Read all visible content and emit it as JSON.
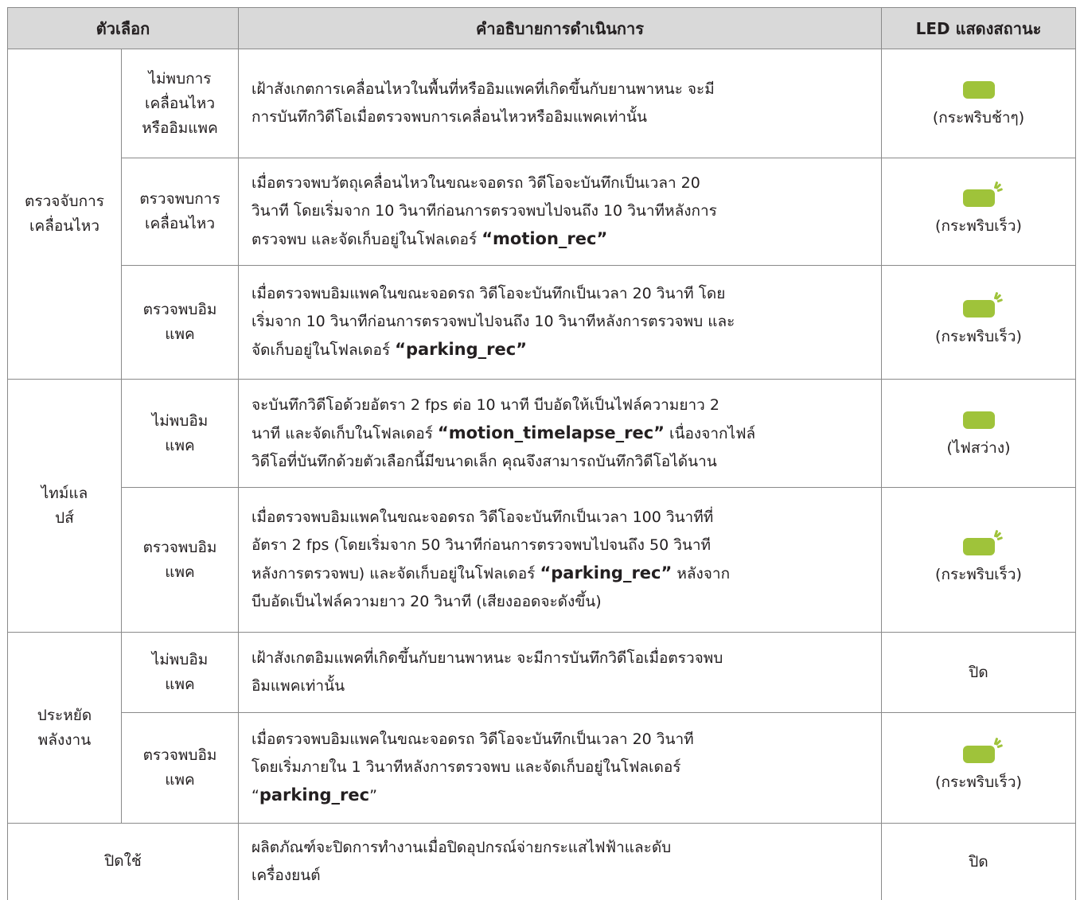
{
  "header": {
    "option": "ตัวเลือก",
    "description": "คำอธิบายการดำเนินการ",
    "led": "LED แสดงสถานะ"
  },
  "colors": {
    "led_green": "#9fc33a",
    "header_bg": "#d9d9d9",
    "grid": "#8a8a8a"
  },
  "groups": [
    {
      "name": [
        "ตรวจจับการ",
        "เคลื่อนไหว"
      ]
    },
    {
      "name": [
        "ไทม์แล",
        "ปส์"
      ]
    },
    {
      "name": [
        "ประหยัด",
        "พลังงาน"
      ]
    }
  ],
  "rows": [
    {
      "sub": [
        "ไม่พบการ",
        "เคลื่อนไหว",
        "หรืออิมแพค"
      ],
      "desc": [
        [
          {
            "t": "เฝ้าสังเกตการเคลื่อนไหวในพื้นที่หรืออิมแพคที่เกิดขึ้นกับยานพาหนะ จะมี"
          }
        ],
        [
          {
            "t": "การบันทึกวิดีโอเมื่อตรวจพบการเคลื่อนไหวหรืออิมแพคเท่านั้น"
          }
        ]
      ],
      "led": {
        "icon": "led-steady-icon",
        "label": "(กระพริบช้าๆ)"
      }
    },
    {
      "sub": [
        "ตรวจพบการ",
        "เคลื่อนไหว"
      ],
      "desc": [
        [
          {
            "t": "เมื่อตรวจพบวัตถุเคลื่อนไหวในขณะจอดรถ วิดีโอจะบันทึกเป็นเวลา 20"
          }
        ],
        [
          {
            "t": "วินาที โดยเริ่มจาก 10 วินาทีก่อนการตรวจพบไปจนถึง 10 วินาทีหลังการ"
          }
        ],
        [
          {
            "t": "ตรวจพบ และจัดเก็บอยู่ในโฟลเดอร์ "
          },
          {
            "t": "“motion_rec”",
            "b": true
          }
        ]
      ],
      "led": {
        "icon": "led-blinking-icon",
        "label": "(กระพริบเร็ว)"
      }
    },
    {
      "sub": [
        "ตรวจพบอิม",
        "แพค"
      ],
      "desc": [
        [
          {
            "t": "เมื่อตรวจพบอิมแพคในขณะจอดรถ วิดีโอจะบันทึกเป็นเวลา 20 วินาที โดย"
          }
        ],
        [
          {
            "t": "เริ่มจาก 10 วินาทีก่อนการตรวจพบไปจนถึง 10 วินาทีหลังการตรวจพบ และ"
          }
        ],
        [
          {
            "t": "จัดเก็บอยู่ในโฟลเดอร์ "
          },
          {
            "t": "“parking_rec”",
            "b": true
          }
        ]
      ],
      "led": {
        "icon": "led-blinking-icon",
        "label": "(กระพริบเร็ว)"
      }
    },
    {
      "sub": [
        "ไม่พบอิม",
        "แพค"
      ],
      "desc": [
        [
          {
            "t": "จะบันทึกวิดีโอด้วยอัตรา 2 fps ต่อ 10 นาที บีบอัดให้เป็นไฟล์ความยาว 2"
          }
        ],
        [
          {
            "t": "นาที และจัดเก็บในโฟลเดอร์ "
          },
          {
            "t": "“motion_timelapse_rec”",
            "b": true
          },
          {
            "t": " เนื่องจากไฟล์"
          }
        ],
        [
          {
            "t": "วิดีโอที่บันทึกด้วยตัวเลือกนี้มีขนาดเล็ก คุณจึงสามารถบันทึกวิดีโอได้นาน"
          }
        ]
      ],
      "led": {
        "icon": "led-steady-icon",
        "label": "(ไฟสว่าง)"
      }
    },
    {
      "sub": [
        "ตรวจพบอิม",
        "แพค"
      ],
      "desc": [
        [
          {
            "t": "เมื่อตรวจพบอิมแพคในขณะจอดรถ วิดีโอจะบันทึกเป็นเวลา 100 วินาทีที่"
          }
        ],
        [
          {
            "t": "อัตรา 2 fps (โดยเริ่มจาก 50 วินาทีก่อนการตรวจพบไปจนถึง 50 วินาที"
          }
        ],
        [
          {
            "t": "หลังการตรวจพบ) และจัดเก็บอยู่ในโฟลเดอร์ "
          },
          {
            "t": "“parking_rec”",
            "b": true
          },
          {
            "t": " หลังจาก"
          }
        ],
        [
          {
            "t": "บีบอัดเป็นไฟล์ความยาว 20 วินาที (เสียงออดจะดังขึ้น)"
          }
        ]
      ],
      "led": {
        "icon": "led-blinking-icon",
        "label": "(กระพริบเร็ว)"
      }
    },
    {
      "sub": [
        "ไม่พบอิม",
        "แพค"
      ],
      "desc": [
        [
          {
            "t": "เฝ้าสังเกตอิมแพคที่เกิดขึ้นกับยานพาหนะ จะมีการบันทึกวิดีโอเมื่อตรวจพบ"
          }
        ],
        [
          {
            "t": "อิมแพคเท่านั้น"
          }
        ]
      ],
      "led": {
        "label": "ปิด"
      }
    },
    {
      "sub": [
        "ตรวจพบอิม",
        "แพค"
      ],
      "desc": [
        [
          {
            "t": "เมื่อตรวจพบอิมแพคในขณะจอดรถ วิดีโอจะบันทึกเป็นเวลา 20 วินาที"
          }
        ],
        [
          {
            "t": "โดยเริ่มภายใน 1 วินาทีหลังการตรวจพบ และจัดเก็บอยู่ในโฟลเดอร์"
          }
        ],
        [
          {
            "t": "“"
          },
          {
            "t": "parking_rec",
            "b": true
          },
          {
            "t": "”"
          }
        ]
      ],
      "led": {
        "icon": "led-blinking-icon",
        "label": "(กระพริบเร็ว)"
      }
    },
    {
      "option": "ปิดใช้",
      "desc": [
        [
          {
            "t": "ผลิตภัณฑ์จะปิดการทำงานเมื่อปิดอุปกรณ์จ่ายกระแสไฟฟ้าและดับ"
          }
        ],
        [
          {
            "t": "เครื่องยนต์"
          }
        ]
      ],
      "led": {
        "label": "ปิด"
      }
    }
  ]
}
